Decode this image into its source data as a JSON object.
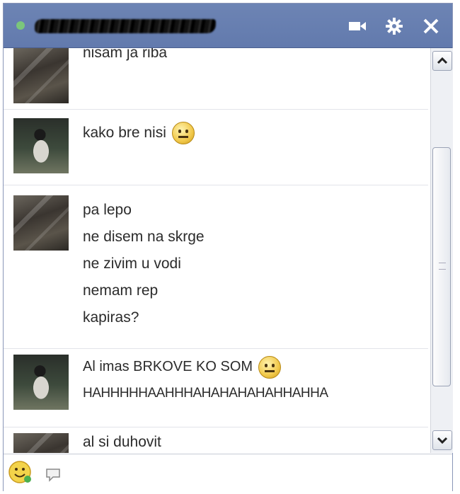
{
  "window": {
    "contact_name": "",
    "icons": {
      "video": "video-camera-icon",
      "settings": "gear-icon",
      "close": "close-icon"
    },
    "colors": {
      "titlebar": "#6d84b4",
      "status_online": "#7bc67b"
    }
  },
  "messages": [
    {
      "avatar": "friend-avatar",
      "lines": [
        "nisam ja riba"
      ],
      "emoji": false
    },
    {
      "avatar": "user-avatar",
      "lines": [
        "kako bre nisi"
      ],
      "emoji": true
    },
    {
      "avatar": "friend-avatar",
      "lines": [
        "pa lepo",
        "ne disem na skrge",
        "ne zivim u vodi",
        "nemam rep",
        "kapiras?"
      ],
      "emoji": false
    },
    {
      "avatar": "user-avatar",
      "lines": [
        "Al imas BRKOVE KO SOM",
        "HAHHHHHAAHHHAHAHAHAHAHHAHHA"
      ],
      "emoji": true
    },
    {
      "avatar": "friend-avatar",
      "lines": [
        "al si duhovit"
      ],
      "emoji": false
    }
  ],
  "composer": {
    "smiley_icon": "smiley-icon",
    "emote_picker_icon": "emote-picker-icon"
  }
}
